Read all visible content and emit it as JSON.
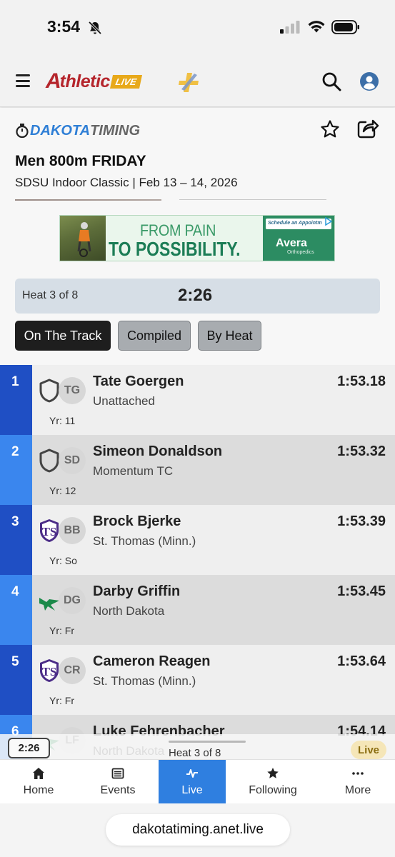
{
  "status_bar": {
    "time": "3:54"
  },
  "header": {
    "logo_main": "thletic",
    "logo_prefix": "A",
    "logo_live": "LIVE"
  },
  "org": {
    "name_part1": "DAKOTA",
    "name_part2": "TIMING"
  },
  "event": {
    "title": "Men 800m FRIDAY",
    "subtitle": "SDSU Indoor Classic | Feb 13 – 14, 2026"
  },
  "ad": {
    "line1": "FROM PAIN",
    "line2": "TO POSSIBILITY.",
    "cta": "Schedule an Appointm",
    "brand": "Avera",
    "brand_sub": "Orthopedics"
  },
  "heat": {
    "label": "Heat 3 of 8",
    "clock": "2:26"
  },
  "tabs": [
    {
      "label": "On The Track",
      "active": true
    },
    {
      "label": "Compiled",
      "active": false
    },
    {
      "label": "By Heat",
      "active": false
    }
  ],
  "results": [
    {
      "place": "1",
      "initials": "TG",
      "name": "Tate Goergen",
      "team": "Unattached",
      "year": "Yr: 11",
      "time": "1:53.18",
      "logo": "shield-icon"
    },
    {
      "place": "2",
      "initials": "SD",
      "name": "Simeon Donaldson",
      "team": "Momentum TC",
      "year": "Yr: 12",
      "time": "1:53.32",
      "logo": "shield-icon"
    },
    {
      "place": "3",
      "initials": "BB",
      "name": "Brock Bjerke",
      "team": "St. Thomas (Minn.)",
      "year": "Yr: So",
      "time": "1:53.39",
      "logo": "st-thomas-logo"
    },
    {
      "place": "4",
      "initials": "DG",
      "name": "Darby Griffin",
      "team": "North Dakota",
      "year": "Yr: Fr",
      "time": "1:53.45",
      "logo": "north-dakota-logo"
    },
    {
      "place": "5",
      "initials": "CR",
      "name": "Cameron Reagen",
      "team": "St. Thomas (Minn.)",
      "year": "Yr: Fr",
      "time": "1:53.64",
      "logo": "st-thomas-logo"
    },
    {
      "place": "6",
      "initials": "LF",
      "name": "Luke Fehrenbacher",
      "team": "North Dakota",
      "year": "",
      "time": "1:54.14",
      "logo": "north-dakota-logo"
    }
  ],
  "mini_bar": {
    "clock": "2:26",
    "heat": "Heat 3 of 8",
    "live": "Live"
  },
  "nav": {
    "home": "Home",
    "events": "Events",
    "live": "Live",
    "following": "Following",
    "more": "More"
  },
  "browser": {
    "url": "dakotatiming.anet.live"
  },
  "colors": {
    "accent_blue": "#2f7fe0",
    "place_dark": "#1f4fc4",
    "place_light": "#3a86ee",
    "row_light": "#efefef",
    "row_dark": "#dcdcdc"
  }
}
